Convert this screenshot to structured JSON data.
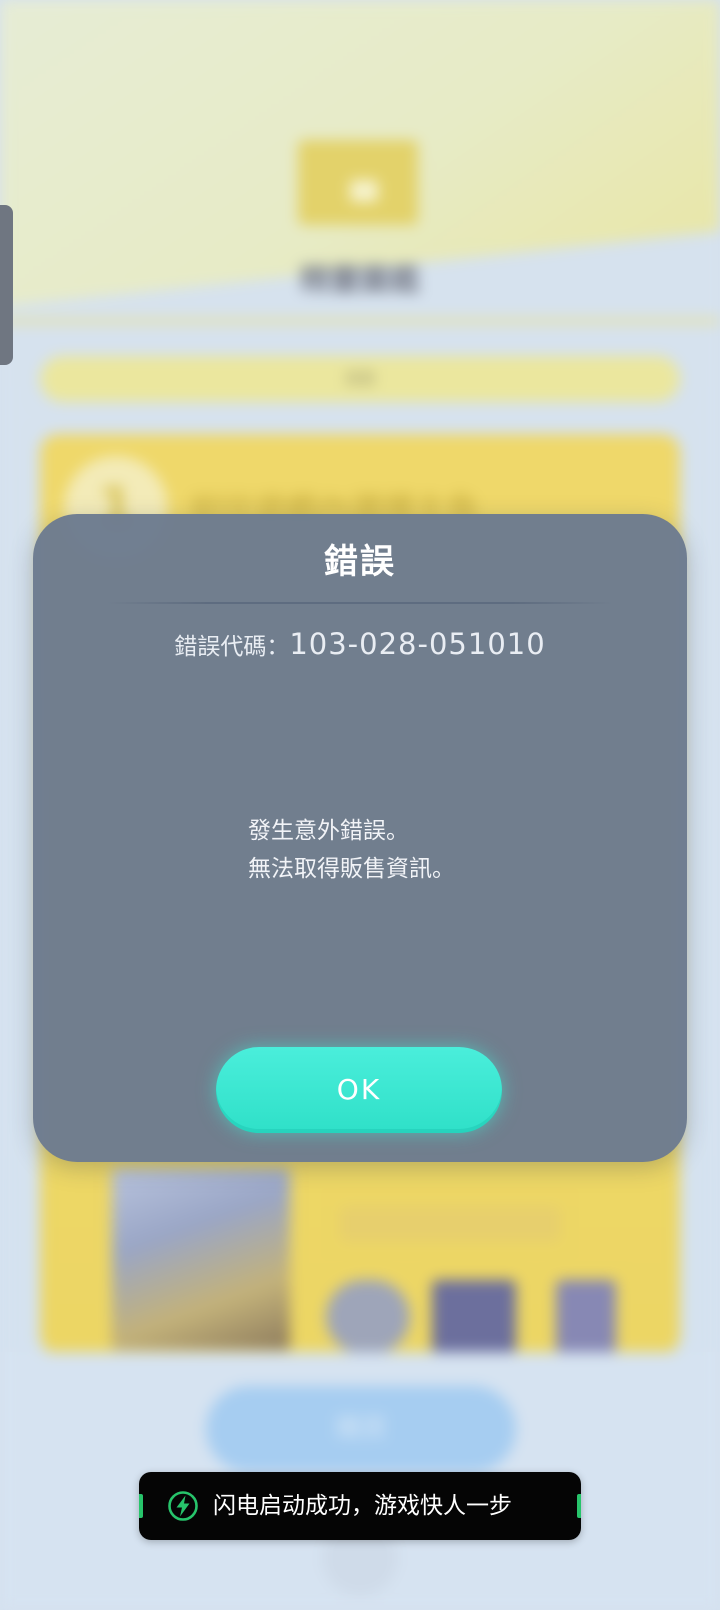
{
  "background": {
    "header_title": "精靈圖鑑",
    "pill_label": "消息",
    "step_number": "1",
    "step_text": "前往遊戲內選擇主角",
    "card_caption": "可玩的遊戲列表",
    "bottom_button_label": "購買"
  },
  "dialog": {
    "title": "錯誤",
    "error_code_label": "錯誤代碼：",
    "error_code": "103-028-051010",
    "message_lines": [
      "發生意外錯誤。",
      "無法取得販售資訊。"
    ],
    "ok_label": "OK"
  },
  "toast": {
    "icon": "lightning-bolt-icon",
    "text": "闪电启动成功，游戏快人一步"
  },
  "colors": {
    "dialog_bg": "#6c7b8f",
    "ok_button": "#3ee8d2",
    "toast_bg": "#050505",
    "toast_accent": "#27c46b"
  }
}
